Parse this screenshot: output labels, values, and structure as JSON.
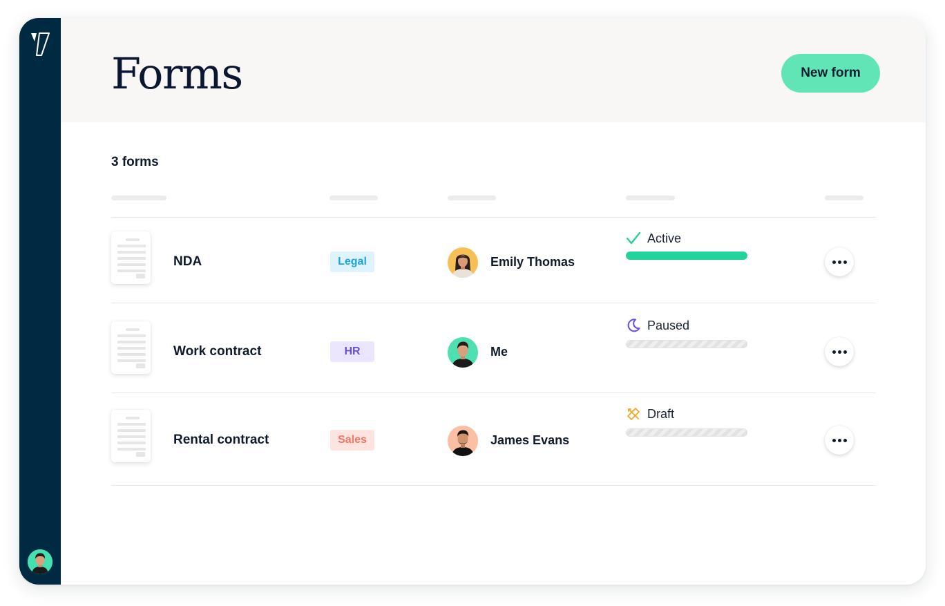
{
  "app": {
    "logo_icon": "brand-slash-logo-icon",
    "user_avatar_icon": "user-avatar",
    "sidebar_color": "#002a42"
  },
  "header": {
    "title": "Forms",
    "new_form_label": "New form",
    "accent_color": "#61e4b6"
  },
  "main": {
    "count_label": "3 forms"
  },
  "forms": [
    {
      "name": "NDA",
      "tag": {
        "label": "Legal",
        "bg": "#dff3fd",
        "color": "#1aa6e4"
      },
      "owner": {
        "name": "Emily Thomas",
        "avatar_bg": "#f6c057"
      },
      "status": {
        "label": "Active",
        "icon": "checkmark-icon",
        "color": "#22d39c",
        "progress": 1.0
      }
    },
    {
      "name": "Work contract",
      "tag": {
        "label": "HR",
        "bg": "#ebe5ff",
        "color": "#6a4fd6"
      },
      "owner": {
        "name": "Me",
        "avatar_bg": "#4fe0b2"
      },
      "status": {
        "label": "Paused",
        "icon": "moon-icon",
        "color": "#6c4ce6",
        "progress": 0
      }
    },
    {
      "name": "Rental contract",
      "tag": {
        "label": "Sales",
        "bg": "#fde4e0",
        "color": "#f27563"
      },
      "owner": {
        "name": "James Evans",
        "avatar_bg": "#fbbfa6"
      },
      "status": {
        "label": "Draft",
        "icon": "pencil-ruler-icon",
        "color": "#f5a623",
        "progress": 0
      }
    }
  ]
}
